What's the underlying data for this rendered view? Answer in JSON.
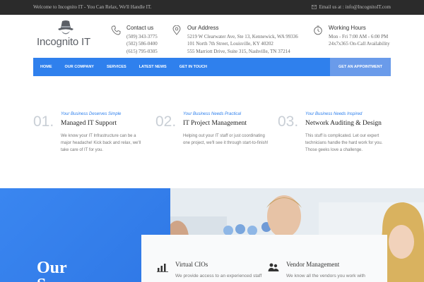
{
  "topbar": {
    "welcome": "Welcome to Incognito IT - You Can Relax, We'll Handle IT.",
    "email": "Email us at : info@IncognitoIT.com",
    "email_icon": "envelope-icon"
  },
  "brand": {
    "name": "Incognito IT",
    "logo_icon": "spy-hat-icon"
  },
  "contact": {
    "title": "Contact us",
    "icon": "phone-icon",
    "lines": [
      "(509) 343-3775",
      "(502) 586-0400",
      "(615) 795-0305"
    ]
  },
  "address": {
    "title": "Our Address",
    "icon": "map-pin-icon",
    "lines": [
      "5219 W Clearwater Ave, Ste 13, Kennewick, WA 99336",
      "101 North 7th Street, Louisville, KY 40202",
      "555 Marriott Drive, Suite 315, Nashville, TN 37214"
    ]
  },
  "hours": {
    "title": "Working Hours",
    "icon": "clock-icon",
    "lines": [
      "Mon - Fri 7:00 AM - 6:00 PM",
      "24x7x365 On-Call Availability"
    ]
  },
  "nav": {
    "items": [
      "HOME",
      "OUR COMPANY",
      "SERVICES",
      "LATEST NEWS",
      "GET IN TOUCH"
    ],
    "cta": "GET AN APPOINTMENT",
    "color": "#2f80ed"
  },
  "features": [
    {
      "num": "01.",
      "tag": "Your Business Deserves Simple",
      "title": "Managed IT Support",
      "desc": "We know your IT Infrastructure can be a major headache! Kick back and relax, we'll take care of IT for you."
    },
    {
      "num": "02.",
      "tag": "Your Business Needs Practical",
      "title": "IT Project Management",
      "desc": "Helping out your IT staff or just coordinating one project, we'll see it through start-to-finish!"
    },
    {
      "num": "03.",
      "tag": "Your Business Needs Inspired",
      "title": "Network Auditing & Design",
      "desc": "This stuff is complicated. Let our expert technicians handle the hard work for you. Those geeks love a challenge."
    }
  ],
  "band": {
    "heading_line1": "Our",
    "heading_line2": "S"
  },
  "services": [
    {
      "icon": "bar-chart-icon",
      "title": "Virtual CIOs",
      "desc": "We provide access to an experienced staff"
    },
    {
      "icon": "people-icon",
      "title": "Vendor Management",
      "desc": "We know all the vendors you work with"
    }
  ]
}
